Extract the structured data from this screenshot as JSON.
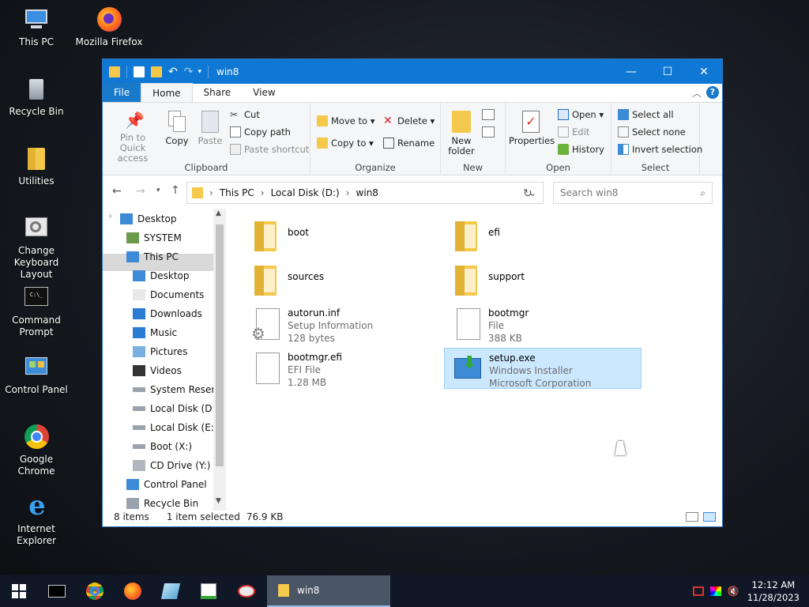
{
  "desktop": {
    "icons": [
      {
        "label": "This PC",
        "icon": "this-pc-icon"
      },
      {
        "label": "Mozilla Firefox",
        "icon": "firefox-icon"
      },
      {
        "label": "Recycle Bin",
        "icon": "recycle-bin-icon"
      },
      {
        "label": "Utilities",
        "icon": "folder-icon"
      },
      {
        "label": "Change Keyboard Layout",
        "icon": "keyboard-settings-icon"
      },
      {
        "label": "Command Prompt",
        "icon": "command-prompt-icon"
      },
      {
        "label": "Control Panel",
        "icon": "control-panel-icon"
      },
      {
        "label": "Google Chrome",
        "icon": "chrome-icon"
      },
      {
        "label": "Internet Explorer",
        "icon": "internet-explorer-icon"
      }
    ]
  },
  "window": {
    "title": "win8",
    "minimize": "—",
    "maximize": "☐",
    "close": "✕"
  },
  "tabs": {
    "file": "File",
    "home": "Home",
    "share": "Share",
    "view": "View"
  },
  "ribbon": {
    "clipboard": {
      "label": "Clipboard",
      "pin": "Pin to Quick access",
      "copy": "Copy",
      "paste": "Paste",
      "cut": "Cut",
      "copy_path": "Copy path",
      "paste_shortcut": "Paste shortcut"
    },
    "organize": {
      "label": "Organize",
      "move_to": "Move to ▾",
      "copy_to": "Copy to ▾",
      "delete": "Delete ▾",
      "rename": "Rename"
    },
    "new": {
      "label": "New",
      "new_folder": "New folder"
    },
    "open": {
      "label": "Open",
      "properties": "Properties",
      "open": "Open ▾",
      "edit": "Edit",
      "history": "History"
    },
    "select": {
      "label": "Select",
      "select_all": "Select all",
      "select_none": "Select none",
      "invert": "Invert selection"
    }
  },
  "address": {
    "crumbs": [
      "This PC",
      "Local Disk (D:)",
      "win8"
    ],
    "search_placeholder": "Search win8"
  },
  "nav_pane": [
    {
      "label": "Desktop",
      "icon": "desktop-icon"
    },
    {
      "label": "SYSTEM",
      "icon": "user-icon"
    },
    {
      "label": "This PC",
      "icon": "this-pc-icon"
    },
    {
      "label": "Desktop",
      "icon": "desktop-icon"
    },
    {
      "label": "Documents",
      "icon": "documents-icon"
    },
    {
      "label": "Downloads",
      "icon": "downloads-icon"
    },
    {
      "label": "Music",
      "icon": "music-icon"
    },
    {
      "label": "Pictures",
      "icon": "pictures-icon"
    },
    {
      "label": "Videos",
      "icon": "videos-icon"
    },
    {
      "label": "System Reserve",
      "icon": "drive-icon"
    },
    {
      "label": "Local Disk (D:)",
      "icon": "drive-icon"
    },
    {
      "label": "Local Disk (E:)",
      "icon": "drive-icon"
    },
    {
      "label": "Boot (X:)",
      "icon": "drive-icon"
    },
    {
      "label": "CD Drive (Y:) H",
      "icon": "cd-drive-icon"
    },
    {
      "label": "Control Panel",
      "icon": "control-panel-icon"
    },
    {
      "label": "Recycle Bin",
      "icon": "recycle-bin-icon"
    }
  ],
  "files": [
    {
      "name": "boot",
      "line2": "",
      "line3": "",
      "icon": "folder-icon"
    },
    {
      "name": "efi",
      "line2": "",
      "line3": "",
      "icon": "folder-icon"
    },
    {
      "name": "sources",
      "line2": "",
      "line3": "",
      "icon": "folder-icon"
    },
    {
      "name": "support",
      "line2": "",
      "line3": "",
      "icon": "folder-icon"
    },
    {
      "name": "autorun.inf",
      "line2": "Setup Information",
      "line3": "128 bytes",
      "icon": "settings-file-icon"
    },
    {
      "name": "bootmgr",
      "line2": "File",
      "line3": "388 KB",
      "icon": "file-icon"
    },
    {
      "name": "bootmgr.efi",
      "line2": "EFI File",
      "line3": "1.28 MB",
      "icon": "file-icon"
    },
    {
      "name": "setup.exe",
      "line2": "Windows Installer",
      "line3": "Microsoft Corporation",
      "icon": "installer-icon"
    }
  ],
  "status": {
    "count": "8 items",
    "selected": "1 item selected",
    "size": "76.9 KB"
  },
  "taskbar": {
    "window_label": "win8",
    "time": "12:12 AM",
    "date": "11/28/2023"
  }
}
